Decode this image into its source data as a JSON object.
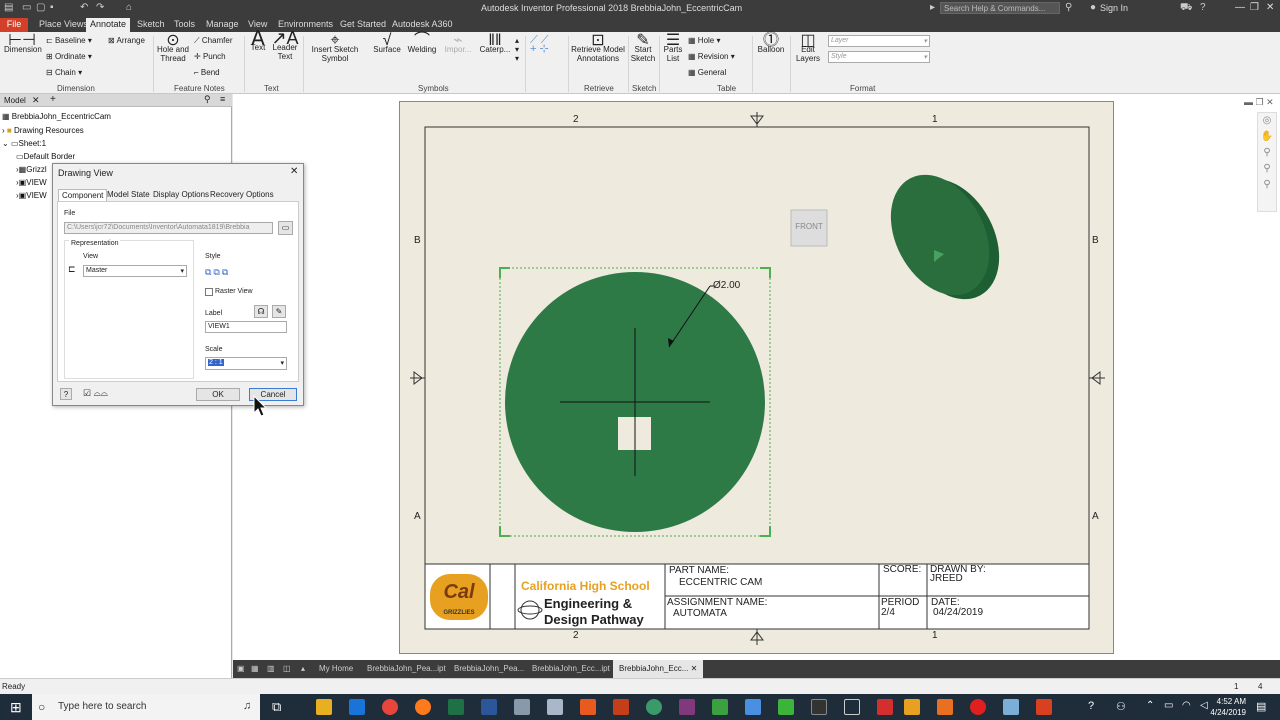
{
  "app": {
    "title": "Autodesk Inventor Professional 2018   BrebbiaJohn_EccentricCam",
    "search_placeholder": "Search Help & Commands...",
    "signin": "Sign In"
  },
  "tabs": [
    "File",
    "Place Views",
    "Annotate",
    "Sketch",
    "Tools",
    "Manage",
    "View",
    "Environments",
    "Get Started",
    "Autodesk A360"
  ],
  "ribbon": {
    "dimension": "Dimension",
    "baseline": "Baseline",
    "ordinate": "Ordinate",
    "chain": "Chain",
    "arrange": "Arrange",
    "hole_thread": "Hole and Thread",
    "chamfer": "Chamfer",
    "punch": "Punch",
    "bend": "Bend",
    "text": "Text",
    "leader_text": "Leader Text",
    "insert_sketch_symbol": "Insert Sketch Symbol",
    "surface": "Surface",
    "welding": "Welding",
    "import": "Impor...",
    "caterpillar": "Caterp...",
    "retrieve_model_annotations": "Retrieve Model Annotations",
    "start_sketch": "Start Sketch",
    "parts_list": "Parts List",
    "hole": "Hole",
    "revision": "Revision",
    "general": "General",
    "balloon": "Balloon",
    "edit_layers": "Edit Layers",
    "layer_placeholder": "Layer",
    "style_placeholder": "Style",
    "groups": {
      "dimension": "Dimension",
      "feature_notes": "Feature Notes",
      "text": "Text",
      "symbols": "Symbols",
      "retrieve": "Retrieve",
      "sketch": "Sketch",
      "table": "Table",
      "format": "Format"
    }
  },
  "browser": {
    "tab": "Model",
    "items": [
      "BrebbiaJohn_EccentricCam",
      "Drawing Resources",
      "Sheet:1",
      "Default Border",
      "Grizzl",
      "VIEW",
      "VIEW"
    ]
  },
  "dialog": {
    "title": "Drawing View",
    "tabs": [
      "Component",
      "Model State",
      "Display Options",
      "Recovery Options"
    ],
    "file_label": "File",
    "file_path": "C:\\Users\\jcr72\\Documents\\Inventor\\Automata1819\\Brebbia",
    "representation": "Representation",
    "view_label": "View",
    "view_value": "Master",
    "style_label": "Style",
    "raster_view": "Raster View",
    "label_label": "Label",
    "label_value": "VIEW1",
    "scale_label": "Scale",
    "scale_value": "2 : 1",
    "ok": "OK",
    "cancel": "Cancel"
  },
  "sheet": {
    "zone_top": [
      "2",
      "1"
    ],
    "zone_bottom": [
      "2",
      "1"
    ],
    "zone_left": [
      "B",
      "A"
    ],
    "zone_right": [
      "B",
      "A"
    ],
    "dimension": "Ø2.00",
    "front_label": "FRONT",
    "title_block": {
      "school": "California High School",
      "dept_line1": "Engineering &",
      "dept_line2": "Design Pathway",
      "logo_text": "Cal",
      "logo_sub": "GRIZZLIES",
      "part_name_label": "PART NAME:",
      "part_name": "ECCENTRIC CAM",
      "score_label": "SCORE:",
      "drawn_by_label": "DRAWN BY:",
      "drawn_by": "JREED",
      "assignment_label": "ASSIGNMENT NAME:",
      "assignment": "AUTOMATA",
      "period_label": "PERIOD",
      "period": "2/4",
      "date_label": "DATE:",
      "date": "04/24/2019"
    }
  },
  "doc_tabs": [
    "My Home",
    "BrebbiaJohn_Pea...ipt",
    "BrebbiaJohn_Pea...",
    "BrebbiaJohn_Ecc...ipt",
    "BrebbiaJohn_Ecc..."
  ],
  "status": {
    "left": "Ready",
    "n1": "1",
    "n2": "4"
  },
  "taskbar": {
    "search": "Type here to search",
    "time": "4:52 AM",
    "date": "4/24/2019"
  },
  "colors": {
    "part_green": "#2d7a46",
    "accent_orange": "#e8a020",
    "file_red": "#d3402a"
  }
}
